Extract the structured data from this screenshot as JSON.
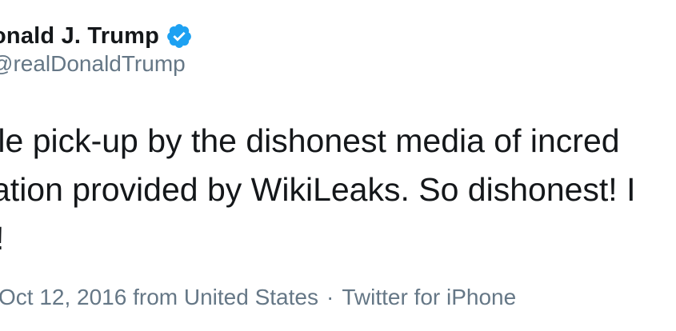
{
  "tweet": {
    "display_name": "onald J. Trump",
    "handle": "realDonaldTrump",
    "text_lines": [
      "tle pick-up by the dishonest media of incred",
      "ation provided by WikiLeaks. So dishonest! I",
      "!"
    ],
    "date": "Oct 12, 2016 from United States",
    "separator": "·",
    "source": "Twitter for iPhone"
  },
  "icons": {
    "verified": "verified-badge-icon"
  },
  "colors": {
    "verified_blue": "#1da1f2",
    "secondary_text": "#657786",
    "primary_text": "#14171a"
  }
}
